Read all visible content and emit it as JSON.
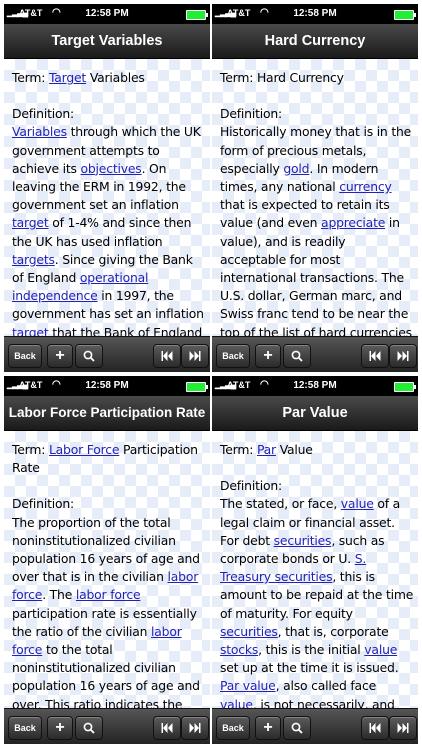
{
  "status": {
    "carrier": "AT&T",
    "time": "12:58 PM"
  },
  "toolbar": {
    "back_label": "Back",
    "add_label": "+"
  },
  "screens": [
    {
      "title": "Target Variables"
    },
    {
      "title": "Hard Currency"
    },
    {
      "title": "Labor Force Participation Rate"
    },
    {
      "title": "Par Value"
    }
  ]
}
